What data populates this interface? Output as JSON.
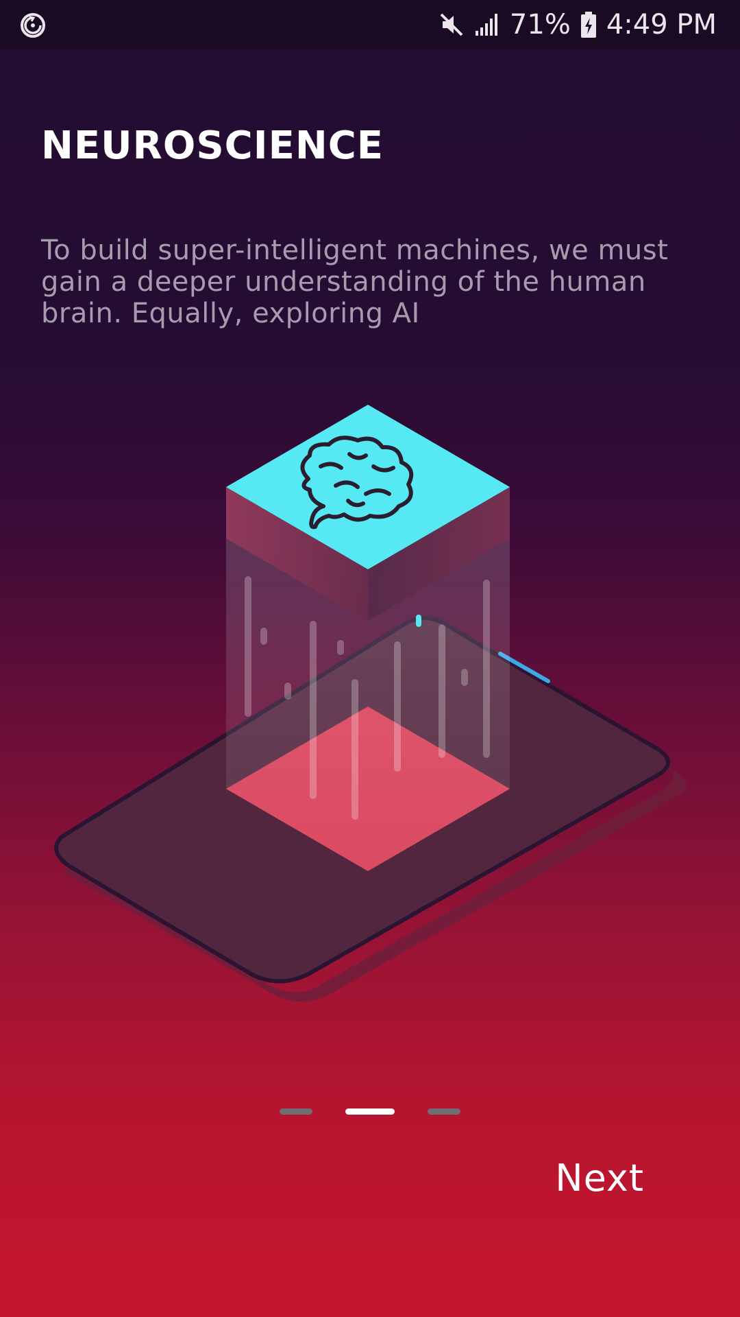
{
  "status_bar": {
    "battery_percent": "71%",
    "time": "4:49 PM",
    "icons": [
      "sync-icon",
      "mute-icon",
      "signal-icon",
      "battery-charging-icon"
    ]
  },
  "onboarding": {
    "title": "NEUROSCIENCE",
    "description": "To build super-intelligent machines, we must gain a deeper understanding of the human brain. Equally, exploring AI",
    "illustration_icon": "brain-phone-illustration",
    "pages_total": 3,
    "current_page": 2,
    "next_label": "Next"
  },
  "colors": {
    "background_top": "#230c31",
    "background_bottom": "#c6152e",
    "cube_top": "#56e9f4",
    "cube_bottom": "#e0405a",
    "indicator_active": "#ffffff",
    "indicator_inactive": "#6f6f74"
  }
}
